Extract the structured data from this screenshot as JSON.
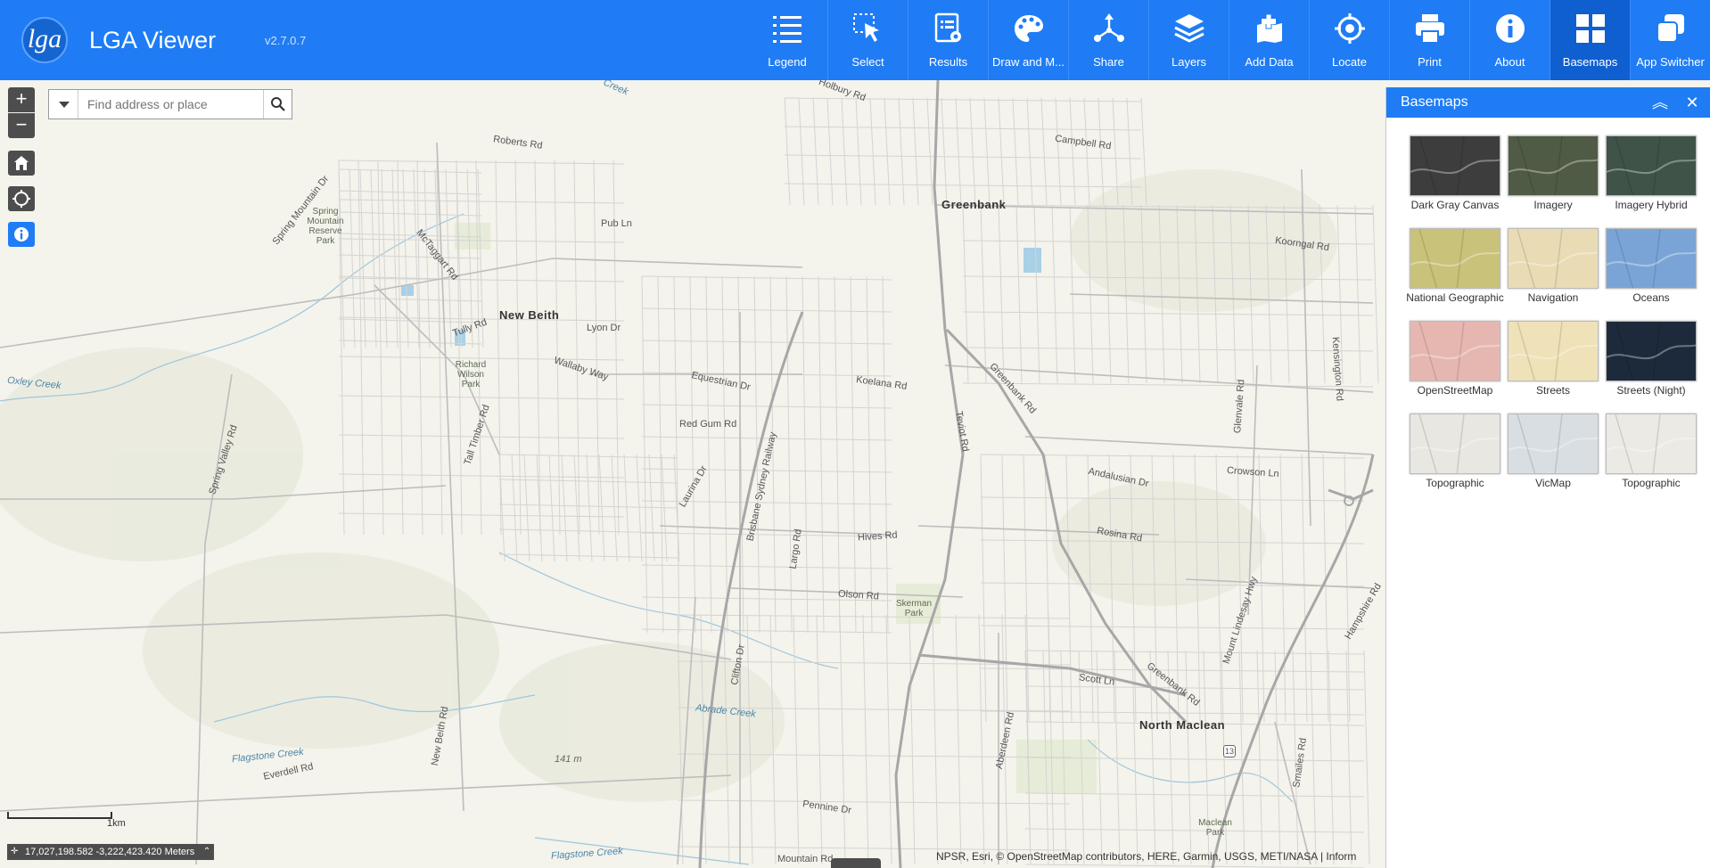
{
  "app": {
    "logo_text": "lga",
    "title": "LGA Viewer",
    "version": "v2.7.0.7"
  },
  "toolbar": [
    {
      "label": "Legend",
      "icon": "legend-icon"
    },
    {
      "label": "Select",
      "icon": "select-icon"
    },
    {
      "label": "Results",
      "icon": "results-icon"
    },
    {
      "label": "Draw and M...",
      "icon": "draw-icon"
    },
    {
      "label": "Share",
      "icon": "share-icon"
    },
    {
      "label": "Layers",
      "icon": "layers-icon"
    },
    {
      "label": "Add Data",
      "icon": "add-data-icon"
    },
    {
      "label": "Locate",
      "icon": "locate-icon"
    },
    {
      "label": "Print",
      "icon": "print-icon"
    },
    {
      "label": "About",
      "icon": "about-icon"
    },
    {
      "label": "Basemaps",
      "icon": "basemaps-icon",
      "active": true
    },
    {
      "label": "App Switcher",
      "icon": "app-switcher-icon"
    }
  ],
  "map": {
    "search_placeholder": "Find address or place",
    "zoom_in": "+",
    "zoom_out": "−",
    "scale_label": "1km",
    "coordinates": "17,027,198.582 -3,222,423.420 Meters",
    "attribution": "NPSR, Esri, © OpenStreetMap contributors, HERE, Garmin, USGS, METI/NASA | Inform",
    "towns": [
      {
        "name": "Greenbank"
      },
      {
        "name": "New Beith"
      },
      {
        "name": "North Maclean"
      }
    ],
    "roads": [
      "Roberts Rd",
      "Pub Ln",
      "Campbell Rd",
      "Koorngal Rd",
      "Tully Rd",
      "Lyon Dr",
      "Wallaby Way",
      "Equestrian Dr",
      "Red Gum Rd",
      "Koelana Rd",
      "Greenbank Rd",
      "Teviot Rd",
      "Andalusian Dr",
      "Crowson Ln",
      "Rosina Rd",
      "Hives Rd",
      "Olson Rd",
      "Scott Ln",
      "Greenbank Rd",
      "Mount Lindesay Hwy",
      "Spring Valley Rd",
      "Everdell Rd",
      "New Beith Rd",
      "Clifton Dr",
      "Pennine Dr",
      "Aberdeen Rd",
      "Smailes Rd",
      "Holbury Rd",
      "Laurina Dr",
      "Largo Rd",
      "Tall Timber Rd",
      "Spring Mountain Dr",
      "McTaggart Rd",
      "Glenvale Rd",
      "Kensington Rd",
      "Mountain Rd",
      "Hampshire Rd",
      "Brisbane Sydney Railway"
    ],
    "water": [
      "Oxley Creek",
      "Flagstone Creek",
      "Abrade Creek",
      "Flagstone Creek",
      "Creek"
    ],
    "parks": [
      "Spring Mountain Reserve Park",
      "Richard Wilson Park",
      "Skerman Park",
      "Maclean Park"
    ],
    "elevation": "141 m",
    "route_shield": "13"
  },
  "basemaps_panel": {
    "title": "Basemaps",
    "items": [
      {
        "label": "Dark Gray Canvas",
        "color": "#3d3d3d"
      },
      {
        "label": "Imagery",
        "color": "#4f5b44"
      },
      {
        "label": "Imagery Hybrid",
        "color": "#3f5348"
      },
      {
        "label": "National Geographic",
        "color": "#c9c27a"
      },
      {
        "label": "Navigation",
        "color": "#e9dcb4"
      },
      {
        "label": "Oceans",
        "color": "#7aa4d6"
      },
      {
        "label": "OpenStreetMap",
        "color": "#e6b7b1"
      },
      {
        "label": "Streets",
        "color": "#efe2b8"
      },
      {
        "label": "Streets (Night)",
        "color": "#1d2a3b"
      },
      {
        "label": "Topographic",
        "color": "#e8e7e2"
      },
      {
        "label": "VicMap",
        "color": "#d9dee2"
      },
      {
        "label": "Topographic",
        "color": "#eceae4"
      }
    ]
  },
  "colors": {
    "header": "#1f7cf5",
    "header_active": "#0f5fd0",
    "map_bg": "#f4f3ec",
    "road": "#c8c8c8",
    "highway": "#a9a9a9",
    "water": "#4b86a8"
  }
}
